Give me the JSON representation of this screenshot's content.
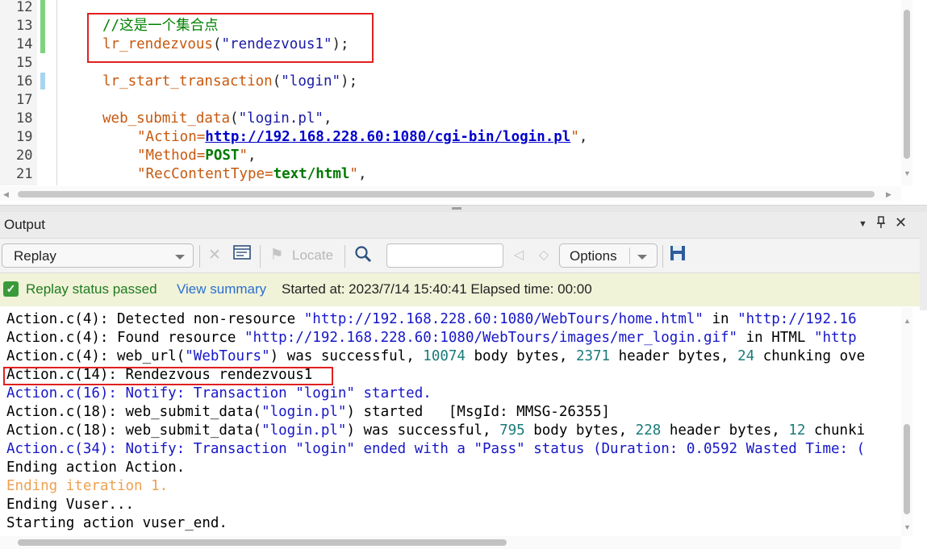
{
  "editor": {
    "line_numbers": [
      "12",
      "13",
      "14",
      "15",
      "16",
      "17",
      "18",
      "19",
      "20",
      "21"
    ],
    "comment": "//这是一个集合点",
    "rendezvous_fn": "lr_rendezvous",
    "rendezvous_arg": "\"rendezvous1\"",
    "start_txn_fn": "lr_start_transaction",
    "start_txn_arg": "\"login\"",
    "submit_fn": "web_submit_data",
    "submit_arg": "\"login.pl\"",
    "action_key": "\"Action=",
    "action_url": "http://192.168.228.60:1080/cgi-bin/login.pl",
    "method_key": "\"Method=",
    "method_val": "POST",
    "rct_key": "\"RecContentType=",
    "rct_val": "text/html"
  },
  "output": {
    "title": "Output",
    "mode": "Replay",
    "locate": "Locate",
    "options": "Options",
    "status": "Replay status passed",
    "view_summary": "View summary",
    "started": "Started at: 2023/7/14 15:40:41 Elapsed time: 00:00"
  },
  "log": {
    "l1a": "Action.c(4): Detected non-resource ",
    "l1b": "\"http://192.168.228.60:1080/WebTours/home.html\"",
    "l1c": " in ",
    "l1d": "\"http://192.16",
    "l2a": "Action.c(4): Found resource ",
    "l2b": "\"http://192.168.228.60:1080/WebTours/images/mer_login.gif\"",
    "l2c": " in HTML ",
    "l2d": "\"http",
    "l3a": "Action.c(4): web_url(",
    "l3b": "\"WebTours\"",
    "l3c": ") was successful, ",
    "l3d": "10074",
    "l3e": " body bytes, ",
    "l3f": "2371",
    "l3g": " header bytes, ",
    "l3h": "24",
    "l3i": " chunking ove",
    "l4": "Action.c(14): Rendezvous rendezvous1",
    "l5": "Action.c(16): Notify: Transaction \"login\" started.",
    "l6a": "Action.c(18): web_submit_data(",
    "l6b": "\"login.pl\"",
    "l6c": ") started   [MsgId: MMSG-26355]",
    "l7a": "Action.c(18): web_submit_data(",
    "l7b": "\"login.pl\"",
    "l7c": ") was successful, ",
    "l7d": "795",
    "l7e": " body bytes, ",
    "l7f": "228",
    "l7g": " header bytes, ",
    "l7h": "12",
    "l7i": " chunki",
    "l8": "Action.c(34): Notify: Transaction \"login\" ended with a \"Pass\" status (Duration: 0.0592 Wasted Time: (",
    "l9": "Ending action Action.",
    "l10": "Ending iteration 1.",
    "l11": "Ending Vuser...",
    "l12": "Starting action vuser_end."
  }
}
